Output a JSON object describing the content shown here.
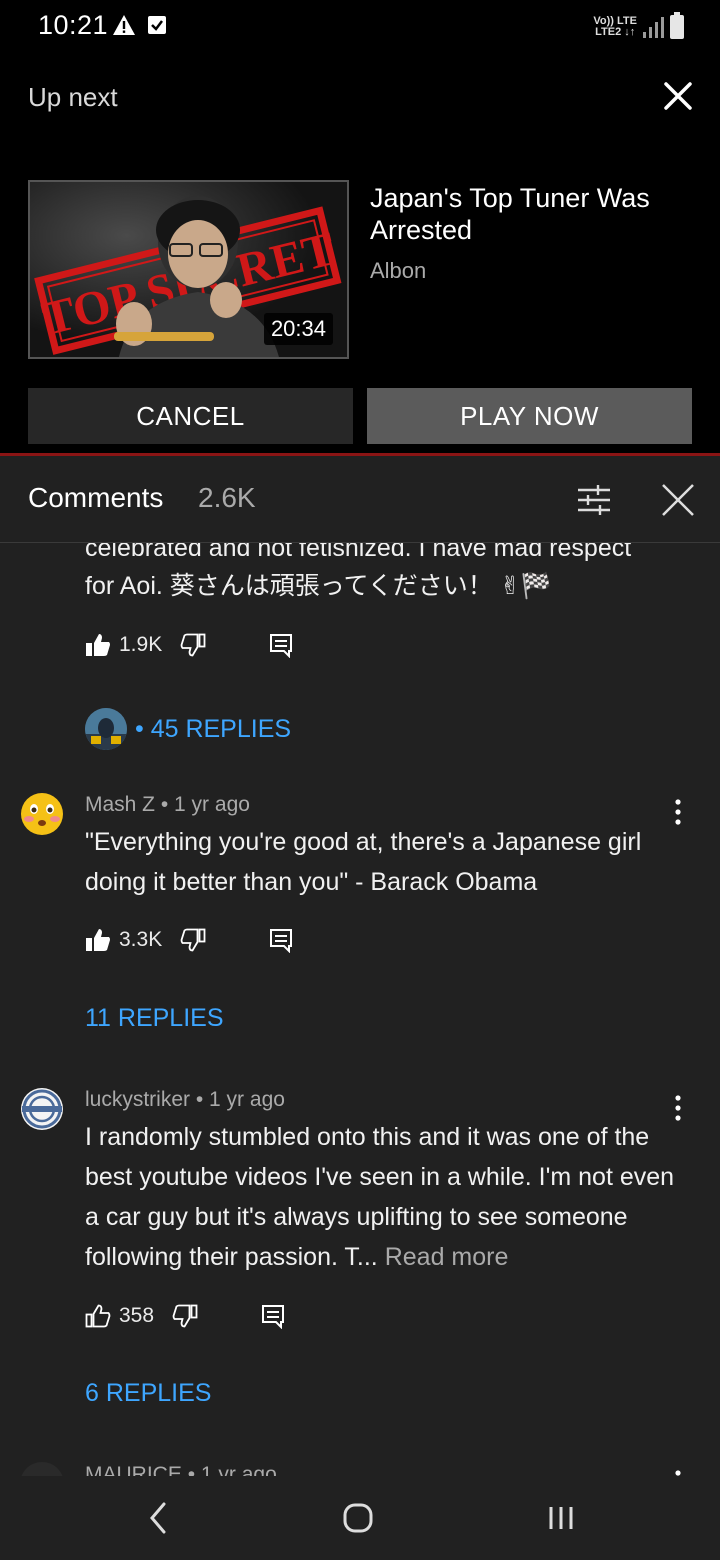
{
  "status_bar": {
    "time": "10:21",
    "network_top": "Vo)) LTE",
    "network_bottom": "LTE2 ↓↑"
  },
  "up_next": {
    "label": "Up next",
    "video": {
      "title": "Japan's Top Tuner Was Arrested",
      "channel": "Albon",
      "duration": "20:34",
      "thumbnail_text": "TOP SECRET"
    },
    "cancel_label": "CANCEL",
    "play_now_label": "PLAY NOW"
  },
  "comments": {
    "title": "Comments",
    "count": "2.6K",
    "items": [
      {
        "text_cut": "celebrated and not fetishized. I have mad respect",
        "text": "for Aoi. 葵さんは頑張ってください！ ✌🏁",
        "likes": "1.9K",
        "replies": "• 45 REPLIES"
      },
      {
        "author": "Mash Z",
        "time": "1 yr ago",
        "text": "\"Everything you're good at, there's a Japanese girl doing it better than you\" - Barack Obama",
        "likes": "3.3K",
        "replies": "11 REPLIES"
      },
      {
        "author": "luckystriker",
        "time": "1 yr ago",
        "text": "I randomly stumbled onto this and it was one of the best youtube videos I've seen in a while. I'm not even a car guy but it's always uplifting to see someone following their passion. T...",
        "read_more": "Read more",
        "likes": "358",
        "replies": "6 REPLIES"
      },
      {
        "author": "MAURICE",
        "time": "1 yr ago"
      }
    ]
  },
  "colors": {
    "background": "#212121",
    "link_blue": "#3ea6ff",
    "secondary_text": "#aaaaaa",
    "accent_red": "#8b1414"
  }
}
